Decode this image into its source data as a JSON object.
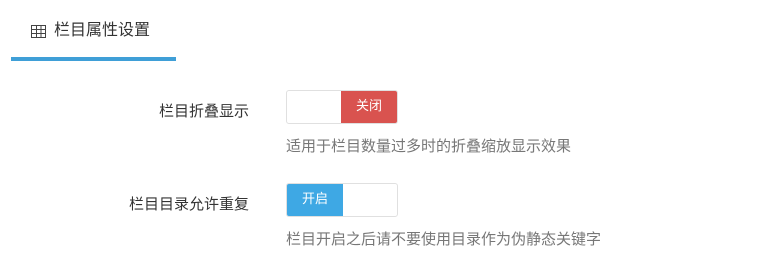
{
  "tab": {
    "icon": "table-icon",
    "label": "栏目属性设置",
    "accent_color": "#3f9fd7"
  },
  "settings": [
    {
      "label": "栏目折叠显示",
      "state": "off",
      "switch_text": "关闭",
      "switch_color": "#d9534f",
      "help": "适用于栏目数量过多时的折叠缩放显示效果"
    },
    {
      "label": "栏目目录允许重复",
      "state": "on",
      "switch_text": "开启",
      "switch_color": "#3ea8e4",
      "help": "栏目开启之后请不要使用目录作为伪静态关键字"
    }
  ]
}
